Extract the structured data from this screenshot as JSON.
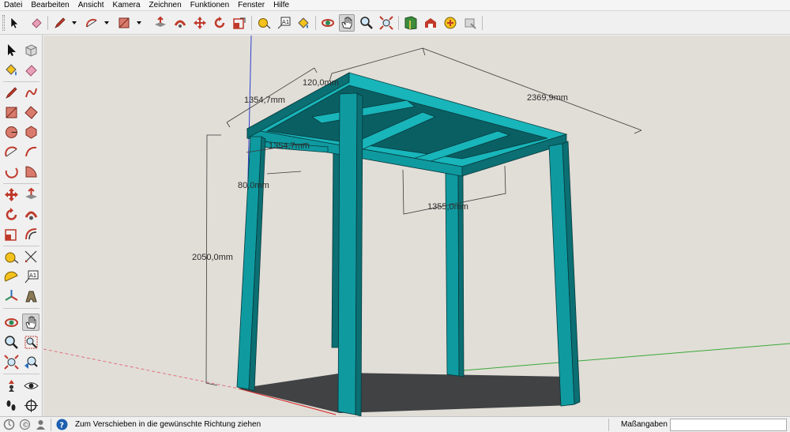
{
  "menu": [
    "Datei",
    "Bearbeiten",
    "Ansicht",
    "Kamera",
    "Zeichnen",
    "Funktionen",
    "Fenster",
    "Hilfe"
  ],
  "toolbar": {
    "tools": [
      "select-icon",
      "eraser-icon",
      "pencil-icon",
      "arc-icon",
      "rectangle-icon",
      "push-pull-icon",
      "follow-me-icon",
      "move-icon",
      "rotate-icon",
      "scale-icon",
      "offset-icon",
      "tape-measure-icon",
      "text-icon",
      "paint-bucket-icon",
      "orbit-icon",
      "pan-icon",
      "zoom-icon",
      "zoom-extents-icon",
      "model-info-icon",
      "warehouse-icon",
      "share-model-icon",
      "extension-icon"
    ],
    "active_tool": "pan-icon"
  },
  "left_toolbar": {
    "tools": [
      "select-icon",
      "make-component-icon",
      "paint-bucket-icon",
      "eraser-icon",
      "line-icon",
      "freehand-icon",
      "rectangle-icon",
      "rotated-rectangle-icon",
      "circle-icon",
      "polygon-icon",
      "arc-icon",
      "two-point-arc-icon",
      "three-point-arc-icon",
      "pie-icon",
      "move-icon",
      "push-pull-icon",
      "rotate-icon",
      "follow-me-icon",
      "scale-icon",
      "offset-icon",
      "tape-measure-icon",
      "dimension-icon",
      "protractor-icon",
      "text-icon",
      "axes-icon",
      "3d-text-icon",
      "orbit-icon",
      "pan-icon",
      "zoom-icon",
      "zoom-window-icon",
      "zoom-extents-icon",
      "previous-view-icon",
      "position-camera-icon",
      "look-around-icon",
      "walk-icon",
      "section-plane-icon"
    ],
    "active_tool": "pan-icon"
  },
  "viewport": {
    "dimensions": {
      "d1": "120,0mm",
      "d2": "2369,9mm",
      "d3": "1354,7mm",
      "d4": "1354,7mm",
      "d5": "80,0mm",
      "d6": "2050,0mm",
      "d7": "1355,0mm"
    }
  },
  "status": {
    "hint": "Zum Verschieben in die gewünschte Richtung ziehen",
    "measurements_label": "Maßangaben",
    "measurements_value": ""
  },
  "colors": {
    "model": "#0f9aa0",
    "model_dark": "#0b6f73",
    "model_light": "#18b5ba",
    "background": "#e1ded7",
    "shadow": "#404244"
  }
}
